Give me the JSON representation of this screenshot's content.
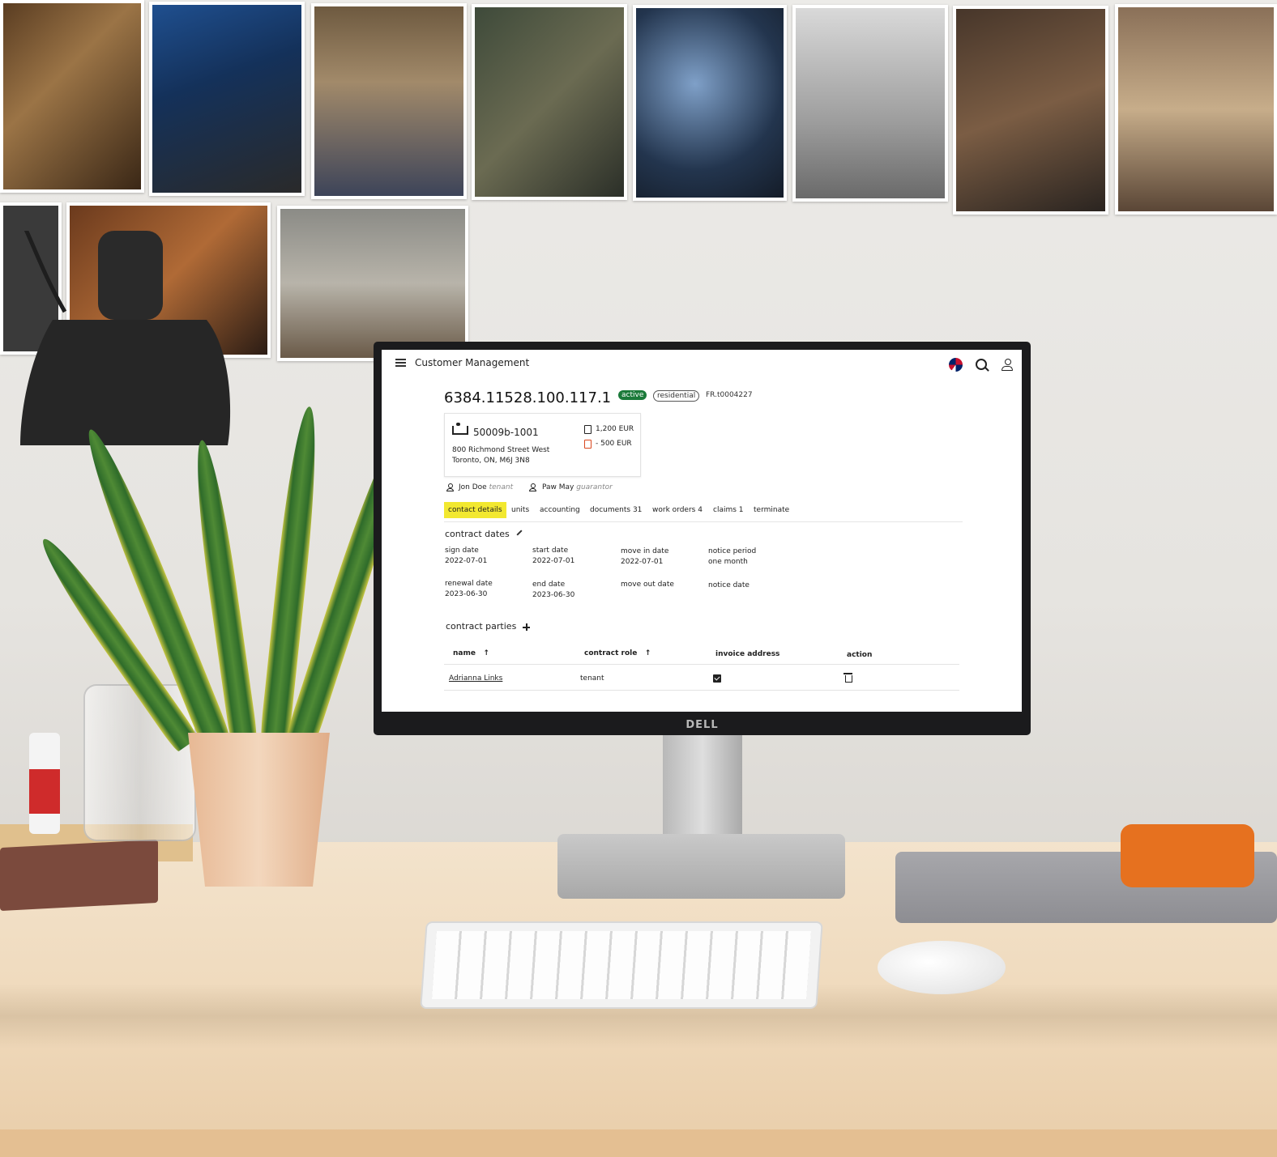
{
  "app": {
    "title": "Customer Management",
    "contract_id": "6384.11528.100.117.1",
    "status_badge": "active",
    "type_badge": "residential",
    "reference": "FR.t0004227"
  },
  "unit_card": {
    "unit_no": "50009b-1001",
    "address_line1": "800 Richmond Street West",
    "address_line2": "Toronto, ON, M6J 3N8",
    "rent": "1,200 EUR",
    "deposit": "- 500 EUR"
  },
  "people": [
    {
      "name": "Jon Doe",
      "role": "tenant"
    },
    {
      "name": "Paw May",
      "role": "guarantor"
    }
  ],
  "tabs": [
    "contact details",
    "units",
    "accounting",
    "documents 31",
    "work orders 4",
    "claims 1",
    "terminate"
  ],
  "contract_dates": {
    "title": "contract dates",
    "sign_date_label": "sign date",
    "sign_date": "2022-07-01",
    "start_date_label": "start date",
    "start_date": "2022-07-01",
    "move_in_label": "move in date",
    "move_in": "2022-07-01",
    "notice_period_label": "notice period",
    "notice_period": "one month",
    "renewal_label": "renewal date",
    "renewal": "2023-06-30",
    "end_date_label": "end date",
    "end_date": "2023-06-30",
    "move_out_label": "move out date",
    "notice_date_label": "notice date"
  },
  "contract_parties": {
    "title": "contract parties",
    "columns": [
      "name",
      "contract role",
      "invoice address",
      "action"
    ],
    "sort_glyph": "↑",
    "rows": [
      {
        "name": "Adrianna Links",
        "role": "tenant",
        "invoice_address": true
      }
    ]
  },
  "monitor_brand": "DELL",
  "colors": {
    "active_badge": "#1b7a3a",
    "tab_highlight": "#f2e830",
    "deposit_icon": "#d9481f",
    "hdd": "#e6711f"
  }
}
